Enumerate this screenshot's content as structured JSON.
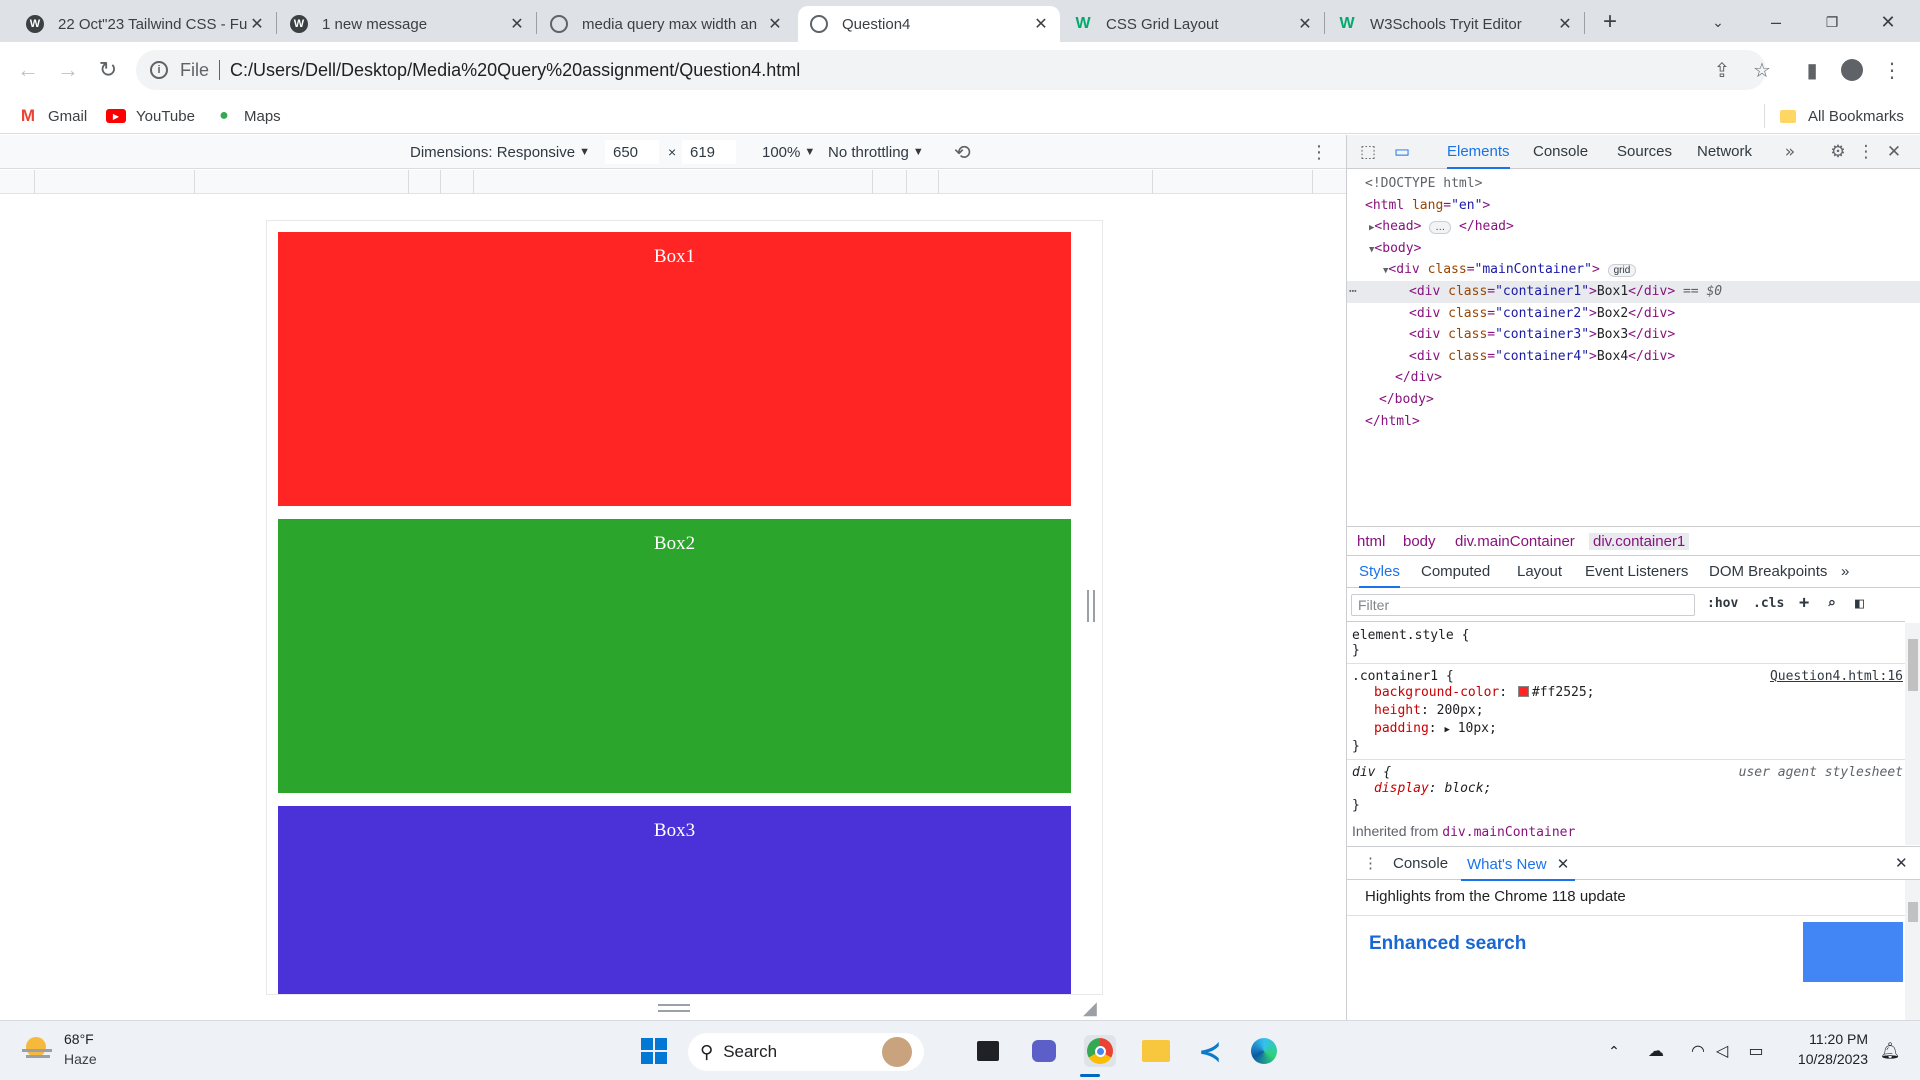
{
  "tabs": [
    {
      "title": "22 Oct\"23 Tailwind CSS - Fu",
      "active": false
    },
    {
      "title": "1 new message",
      "active": false
    },
    {
      "title": "media query max width an",
      "active": false
    },
    {
      "title": "Question4",
      "active": true
    },
    {
      "title": "CSS Grid Layout",
      "active": false
    },
    {
      "title": "W3Schools Tryit Editor",
      "active": false
    }
  ],
  "address": {
    "scheme": "File",
    "url": "C:/Users/Dell/Desktop/Media%20Query%20assignment/Question4.html"
  },
  "bookmarks": [
    "Gmail",
    "YouTube",
    "Maps"
  ],
  "all_bookmarks": "All Bookmarks",
  "device_toolbar": {
    "dimensions": "Dimensions: Responsive",
    "width": "650",
    "times": "×",
    "height": "619",
    "zoom": "100%",
    "throttling": "No throttling"
  },
  "page": {
    "boxes": [
      {
        "label": "Box1",
        "color": "#ff2525"
      },
      {
        "label": "Box2",
        "color": "#2ca52c"
      },
      {
        "label": "Box3",
        "color": "#4b32d8"
      }
    ]
  },
  "devtools": {
    "tabs": [
      "Elements",
      "Console",
      "Sources",
      "Network"
    ],
    "dom": {
      "doctype": "<!DOCTYPE html>",
      "html_open": "html",
      "lang_attr": "lang",
      "lang_val": "\"en\"",
      "head": "head",
      "body": "body",
      "div": "div",
      "class_attr": "class",
      "main_class": "\"mainContainer\"",
      "grid_pill": "grid",
      "children": [
        {
          "cls": "\"container1\"",
          "text": "Box1"
        },
        {
          "cls": "\"container2\"",
          "text": "Box2"
        },
        {
          "cls": "\"container3\"",
          "text": "Box3"
        },
        {
          "cls": "\"container4\"",
          "text": "Box4"
        }
      ],
      "selected_marker": "== $0"
    },
    "breadcrumbs": [
      "html",
      "body",
      "div.mainContainer",
      "div.container1"
    ],
    "subtabs": [
      "Styles",
      "Computed",
      "Layout",
      "Event Listeners",
      "DOM Breakpoints"
    ],
    "filter_placeholder": "Filter",
    "hov": ":hov",
    "cls": ".cls",
    "rules": {
      "element_style": "element.style {",
      "close": "}",
      "container1_selector": ".container1 {",
      "container1_source": "Question4.html:16",
      "bg_name": "background-color",
      "bg_val": "#ff2525;",
      "height_name": "height",
      "height_val": "200px;",
      "padding_name": "padding",
      "padding_val": "10px;",
      "div_selector": "div {",
      "div_source": "user agent stylesheet",
      "display_name": "display",
      "display_val": "block;"
    },
    "inherited_label": "Inherited from",
    "inherited_from": "div.mainContainer",
    "drawer_tabs": [
      "Console",
      "What's New"
    ],
    "highlights": "Highlights from the Chrome 118 update",
    "enhanced": "Enhanced search"
  },
  "taskbar": {
    "temperature": "68°F",
    "weather": "Haze",
    "search": "Search",
    "time": "11:20 PM",
    "date": "10/28/2023"
  }
}
